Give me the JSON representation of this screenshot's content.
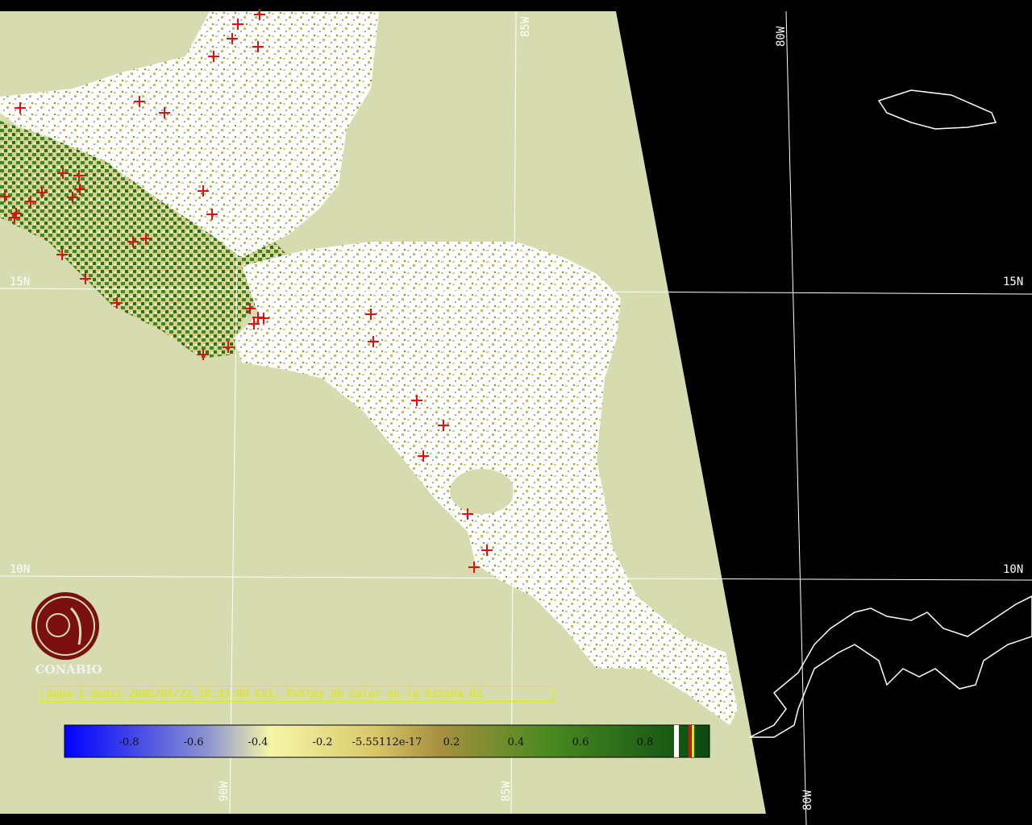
{
  "map": {
    "land_color": "#d6dcb0",
    "nodata_color": "#000000",
    "grid_color": "#ffffff",
    "hotspot_color": "#e01010",
    "grid_labels": {
      "lon_85w_top": "85W",
      "lon_80w_top": "80W",
      "lat_15n_left": "15N",
      "lat_15n_right": "15N",
      "lat_10n_left": "10N",
      "lat_10n_right": "10N",
      "lon_90w_bottom": "90W",
      "lon_85w_bottom": "85W",
      "lon_80w_bottom": "80W"
    }
  },
  "logo": {
    "name": "CONABIO",
    "color": "#7a1010"
  },
  "caption": "aqua-1 modis 2006/04/22 19:33:00 EVI. Puntos de calor en la escena 82",
  "colorbar": {
    "ticks": [
      "-0.8",
      "-0.6",
      "-0.4",
      "-0.2",
      "-5.55112e-17",
      "0.2",
      "0.4",
      "0.6",
      "0.8"
    ],
    "stops": [
      "#0000ff",
      "#8a92d0",
      "#f6f6a8",
      "#d8c868",
      "#a89040",
      "#4a8a20",
      "#0a5a10"
    ]
  }
}
